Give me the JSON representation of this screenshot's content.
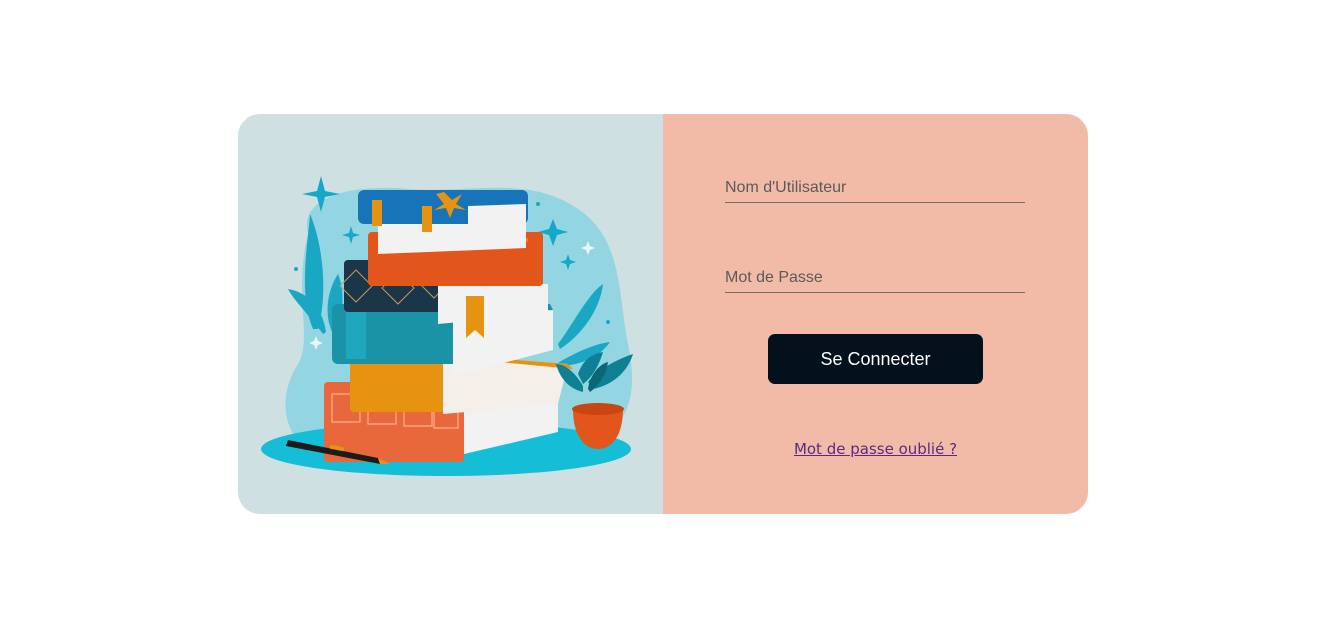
{
  "form": {
    "username_placeholder": "Nom d'Utilisateur",
    "username_value": "",
    "password_placeholder": "Mot de Passe",
    "password_value": "",
    "submit_label": "Se Connecter",
    "forgot_label": "Mot de passe oublié ?"
  },
  "colors": {
    "page_background": "#ffffff",
    "illustration_background": "#cfe0e3",
    "form_background": "#f2bba7",
    "button_background": "#02111b",
    "button_text": "#ffffff",
    "link": "#5a2a82"
  },
  "illustration": {
    "icon": "books-stack-illustration"
  }
}
